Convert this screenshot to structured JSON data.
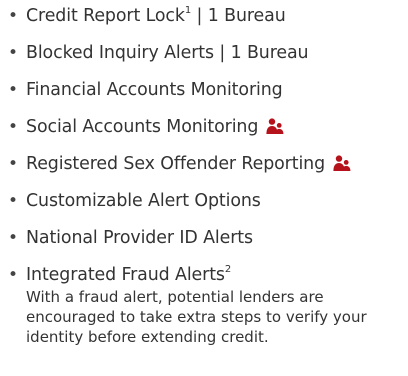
{
  "features": [
    {
      "label": "Credit Report Lock",
      "footnote": "1",
      "suffix": " | 1 Bureau",
      "family_icon": false
    },
    {
      "label": "Blocked Inquiry Alerts | 1 Bureau",
      "footnote": "",
      "suffix": "",
      "family_icon": false
    },
    {
      "label": "Financial Accounts Monitoring",
      "footnote": "",
      "suffix": "",
      "family_icon": false
    },
    {
      "label": "Social Accounts Monitoring",
      "footnote": "",
      "suffix": "",
      "family_icon": true
    },
    {
      "label": "Registered Sex Offender Reporting",
      "footnote": "",
      "suffix": "",
      "family_icon": true
    },
    {
      "label": "Customizable Alert Options",
      "footnote": "",
      "suffix": "",
      "family_icon": false
    },
    {
      "label": "National Provider ID Alerts",
      "footnote": "",
      "suffix": "",
      "family_icon": false
    },
    {
      "label": "Integrated Fraud Alerts",
      "footnote": "2",
      "suffix": "",
      "family_icon": false,
      "description": "With a fraud alert, potential lenders are encouraged to take extra steps to verify your identity before extending credit."
    }
  ],
  "bullet_char": "•",
  "icon_name": "family-icon",
  "colors": {
    "text": "#333333",
    "icon": "#b5121b"
  }
}
